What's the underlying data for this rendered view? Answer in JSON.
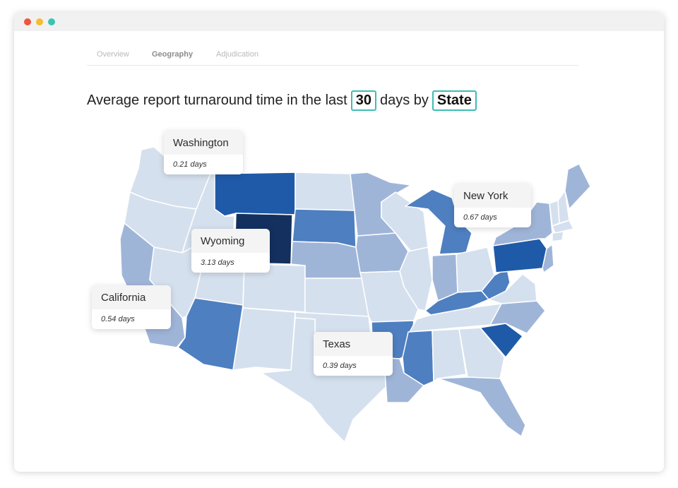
{
  "window": {
    "dots": [
      "#f0563a",
      "#f4bd2f",
      "#3bc4b2"
    ]
  },
  "tabs": [
    {
      "label": "Overview",
      "active": false
    },
    {
      "label": "Geography",
      "active": true
    },
    {
      "label": "Adjudication",
      "active": false
    }
  ],
  "headline": {
    "prefix": "Average report turnaround time in the last",
    "days_value": "30",
    "middle": "days by",
    "group_value": "State"
  },
  "legend_colors": {
    "lightest": "#d5e0ee",
    "light": "#9fb5d8",
    "medium": "#4e7fc0",
    "dark": "#1f5aa8",
    "darkest": "#13305f"
  },
  "callouts": [
    {
      "state": "Washington",
      "value": "0.21 days"
    },
    {
      "state": "New York",
      "value": "0.67 days"
    },
    {
      "state": "Wyoming",
      "value": "3.13 days"
    },
    {
      "state": "California",
      "value": "0.54 days"
    },
    {
      "state": "Texas",
      "value": "0.39 days"
    }
  ]
}
